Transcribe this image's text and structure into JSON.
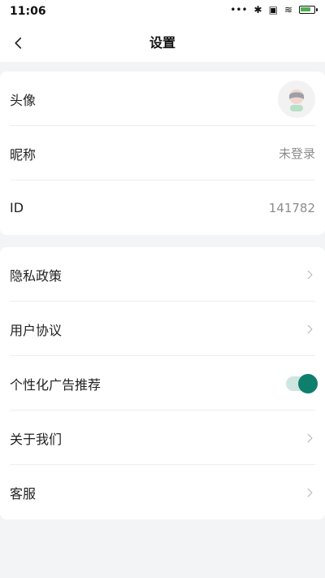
{
  "status_bar": {
    "time": "11:06",
    "icons": [
      "more-icon",
      "bluetooth-icon",
      "sim-icon",
      "wifi-icon",
      "battery-icon"
    ],
    "battery_level_percent": 70
  },
  "header": {
    "title": "设置",
    "back_icon": "chevron-left-icon"
  },
  "profile": {
    "avatar_label": "头像",
    "nickname_label": "昵称",
    "nickname_value": "未登录",
    "id_label": "ID",
    "id_value": "141782"
  },
  "settings": {
    "privacy_label": "隐私政策",
    "agreement_label": "用户协议",
    "personalized_ads_label": "个性化广告推荐",
    "personalized_ads_enabled": true,
    "about_label": "关于我们",
    "support_label": "客服"
  },
  "colors": {
    "accent": "#0e7f6c",
    "background": "#f3f4f6",
    "card": "#ffffff",
    "text_primary": "#222222",
    "text_secondary": "#8c8c8c"
  }
}
